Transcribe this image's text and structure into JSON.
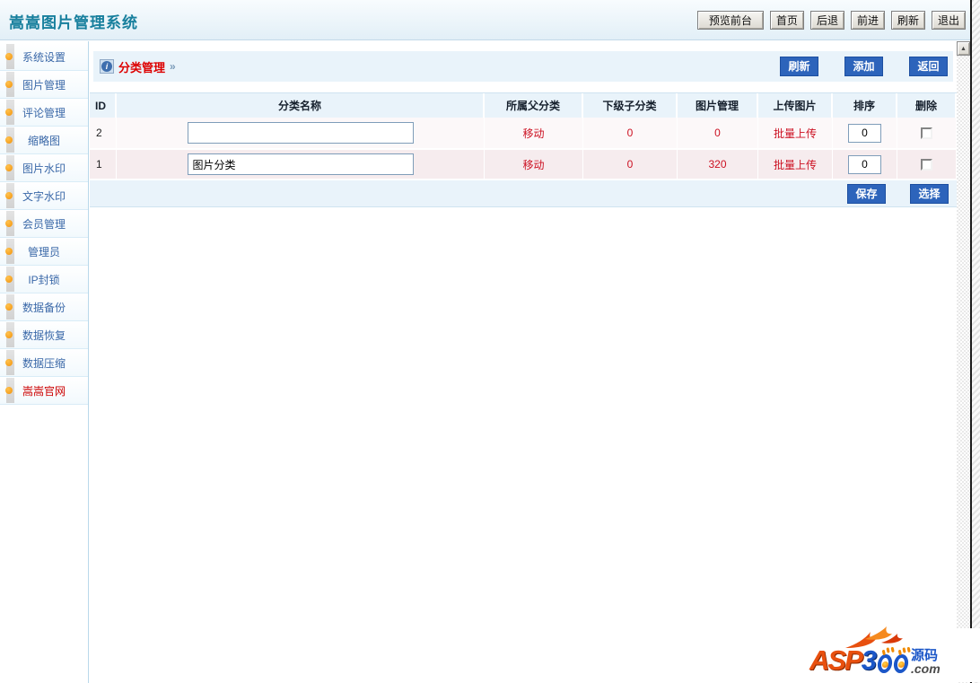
{
  "header": {
    "title": "嵩嵩图片管理系统",
    "nav_buttons": [
      "预览前台",
      "首页",
      "后退",
      "前进",
      "刷新",
      "退出"
    ]
  },
  "sidebar": {
    "items": [
      {
        "label": "系统设置"
      },
      {
        "label": "图片管理"
      },
      {
        "label": "评论管理"
      },
      {
        "label": "缩略图"
      },
      {
        "label": "图片水印"
      },
      {
        "label": "文字水印"
      },
      {
        "label": "会员管理"
      },
      {
        "label": "管理员"
      },
      {
        "label": "IP封锁"
      },
      {
        "label": "数据备份"
      },
      {
        "label": "数据恢复"
      },
      {
        "label": "数据压缩"
      },
      {
        "label": "嵩嵩官网"
      }
    ]
  },
  "main": {
    "breadcrumb": {
      "label": "分类管理",
      "chevron": "»",
      "info_glyph": "i"
    },
    "toolbar": {
      "refresh": "刷新",
      "add": "添加",
      "back": "返回"
    },
    "table": {
      "headers": [
        "ID",
        "分类名称",
        "所属父分类",
        "下级子分类",
        "图片管理",
        "上传图片",
        "排序",
        "删除"
      ],
      "rows": [
        {
          "id": "2",
          "name": "",
          "parent": "移动",
          "children": "0",
          "images": "0",
          "upload": "批量上传",
          "sort": "0"
        },
        {
          "id": "1",
          "name": "图片分类",
          "parent": "移动",
          "children": "0",
          "images": "320",
          "upload": "批量上传",
          "sort": "0"
        }
      ],
      "footer": {
        "save": "保存",
        "select": "选择"
      }
    }
  },
  "scrollbar": {
    "up_glyph": "▲"
  },
  "watermark": {
    "asp": "ASP",
    "three": "3",
    "cn": "源码",
    "com": ".com"
  },
  "colors": {
    "title_teal": "#177f9d",
    "accent_blue_button": "#2d64bb",
    "table_red_text": "#cc1122",
    "breadcrumb_red": "#dd0000",
    "sidebar_link_blue": "#3a68a8",
    "sidebar_dot_orange": "#f2930c",
    "toolbar_band_blue": "#e9f3fa",
    "row_alt_pink": "#f6ecee"
  }
}
